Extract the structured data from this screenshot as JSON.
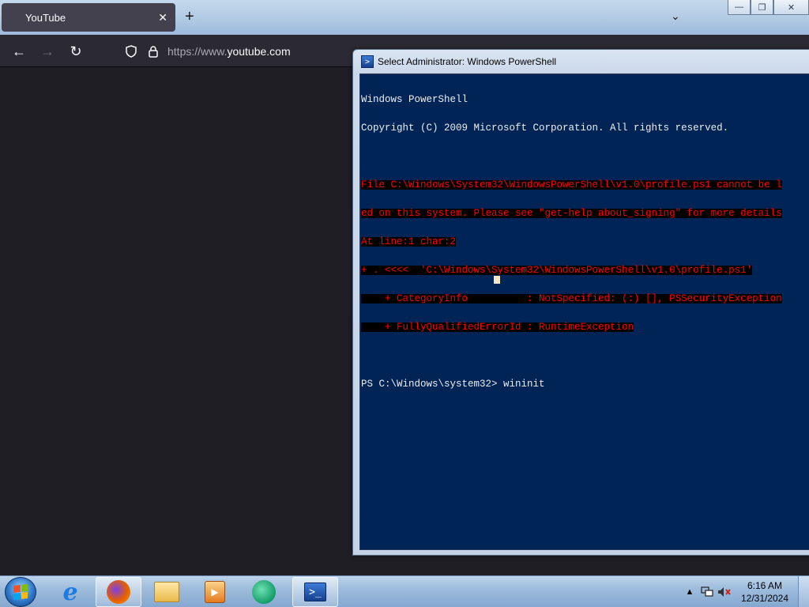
{
  "browser": {
    "tab_title": "YouTube",
    "tab_close_icon": "close-icon",
    "new_tab_icon": "plus-icon",
    "tab_list_icon": "chevron-down-icon",
    "url_prefix": "https://www.",
    "url_domain": "youtube.com",
    "back_icon": "arrow-left-icon",
    "forward_icon": "arrow-right-icon",
    "reload_icon": "reload-icon"
  },
  "powershell": {
    "title": "Select Administrator: Windows PowerShell",
    "lines": {
      "l1": "Windows PowerShell",
      "l2": "Copyright (C) 2009 Microsoft Corporation. All rights reserved.",
      "e1": "File C:\\Windows\\System32\\WindowsPowerShell\\v1.0\\profile.ps1 cannot be l",
      "e2": "ed on this system. Please see \"get-help about_signing\" for more details",
      "e3": "At line:1 char:2",
      "e4": "+ . <<<<  'C:\\Windows\\System32\\WindowsPowerShell\\v1.0\\profile.ps1'",
      "e5": "    + CategoryInfo          : NotSpecified: (:) [], PSSecurityException",
      "e6": "    + FullyQualifiedErrorId : RuntimeException",
      "prompt": "PS C:\\Windows\\system32> wininit"
    },
    "colors": {
      "background": "#012456",
      "error": "#ff0000",
      "text": "#eeedf0"
    }
  },
  "taskbar": {
    "items": [
      {
        "name": "internet-explorer",
        "icon": "ie-icon"
      },
      {
        "name": "firefox",
        "icon": "firefox-icon"
      },
      {
        "name": "file-explorer",
        "icon": "folder-icon"
      },
      {
        "name": "media-player",
        "icon": "media-player-icon"
      },
      {
        "name": "chat-app",
        "icon": "chat-icon"
      },
      {
        "name": "powershell",
        "icon": "powershell-icon"
      }
    ],
    "tray": {
      "time": "6:16 AM",
      "date": "12/31/2024"
    }
  }
}
